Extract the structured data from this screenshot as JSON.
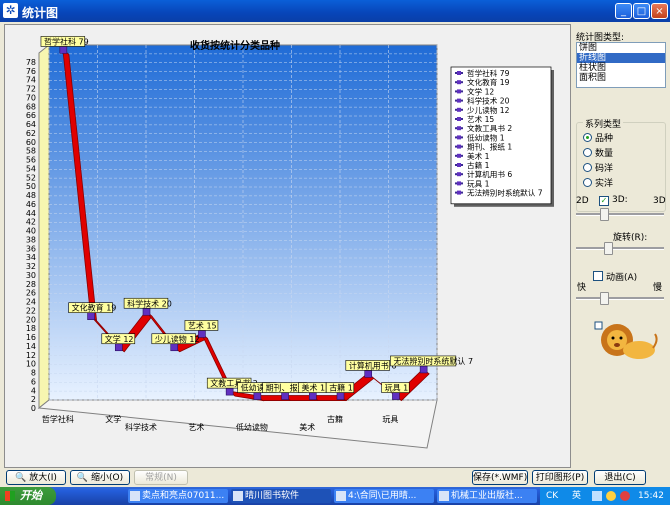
{
  "window": {
    "title": "统计图",
    "app_icon": "grid-app-icon"
  },
  "titlebar_buttons": {
    "minimize": "_",
    "maximize": "□",
    "close": "×"
  },
  "chart_data": {
    "type": "line",
    "title": "收货按统计分类品种",
    "categories": [
      "哲学社科",
      "文化教育",
      "文学",
      "科学技术",
      "少儿读物",
      "艺术",
      "文教工具书",
      "低幼读物",
      "期刊、报纸",
      "美术",
      "古籍",
      "计算机用书",
      "玩具",
      "无法辨别时系统默认"
    ],
    "values": [
      79,
      19,
      12,
      20,
      12,
      15,
      2,
      1,
      1,
      1,
      1,
      6,
      1,
      7
    ],
    "point_labels": [
      "哲学社科 79",
      "文化教育 19",
      "文学 12",
      "科学技术 20",
      "少儿读物 12",
      "艺术 15",
      "文教工具书 2",
      "低幼读物 1",
      "期刊、报纸 1",
      "美术 1",
      "古籍 1",
      "计算机用书 6",
      "玩具 1",
      "无法辨别时系统默认 7"
    ],
    "x_tick_labels": [
      "哲学社科",
      "文学",
      "科学技术",
      "艺术",
      "低幼读物",
      "美术",
      "古籍",
      "玩具"
    ],
    "y_ticks": [
      0,
      2,
      4,
      6,
      8,
      10,
      12,
      14,
      16,
      18,
      20,
      22,
      24,
      26,
      28,
      30,
      32,
      34,
      36,
      38,
      40,
      42,
      44,
      46,
      48,
      50,
      52,
      54,
      56,
      58,
      60,
      62,
      64,
      66,
      68,
      70,
      72,
      74,
      76,
      78
    ],
    "ylim": [
      0,
      80
    ],
    "legend_entries": [
      "哲学社科 79",
      "文化教育 19",
      "文学 12",
      "科学技术 20",
      "少儿读物 12",
      "艺术 15",
      "文教工具书 2",
      "低幼读物 1",
      "期刊、报纸 1",
      "美术 1",
      "古籍 1",
      "计算机用书 6",
      "玩具 1",
      "无法辨别时系统默认 7"
    ],
    "legend_position": "top-right",
    "grid": true,
    "three_d": true,
    "colors": {
      "line": "#e00000",
      "line_dark": "#8a0000",
      "marker": "#6030c0",
      "label_bg": "#ffffa0",
      "wall_top": "#1f6bd6",
      "wall_bottom": "#e8f2ff",
      "wall_left": "#f7f6b0"
    }
  },
  "side": {
    "chart_type_label": "统计图类型:",
    "chart_types": [
      "饼图",
      "折线图",
      "柱状图",
      "面积图"
    ],
    "chart_type_selected": 1,
    "series_label": "系列类型",
    "series_options": [
      "品种",
      "数量",
      "码洋",
      "实洋"
    ],
    "series_selected": 0,
    "label_2d": "2D",
    "label_3d_check": "3D:",
    "label_3d": "3D",
    "three_d_checked": true,
    "depth_level": 0.3,
    "rotate_label": "旋转(R):",
    "rotate_level": 0.35,
    "animate_label": "动画(A)",
    "speed_fast": "快",
    "speed_slow": "慢",
    "speed_level": 0.3,
    "mascot_icon": "lion-mascot-icon"
  },
  "bottom": {
    "zoom_in": "放大(I)",
    "zoom_out": "缩小(O)",
    "normal": "常规(N)",
    "save": "保存(*.WMF)",
    "print": "打印图形(P)",
    "exit": "退出(C)"
  },
  "taskbar": {
    "start": "开始",
    "tasks": [
      "卖点和亮点07011...",
      "晴川图书软件",
      "4:\\合同\\已用晴...",
      "机械工业出版社..."
    ],
    "active_task": 1,
    "ime": "CK",
    "lang": "英",
    "clock": "15:42"
  }
}
